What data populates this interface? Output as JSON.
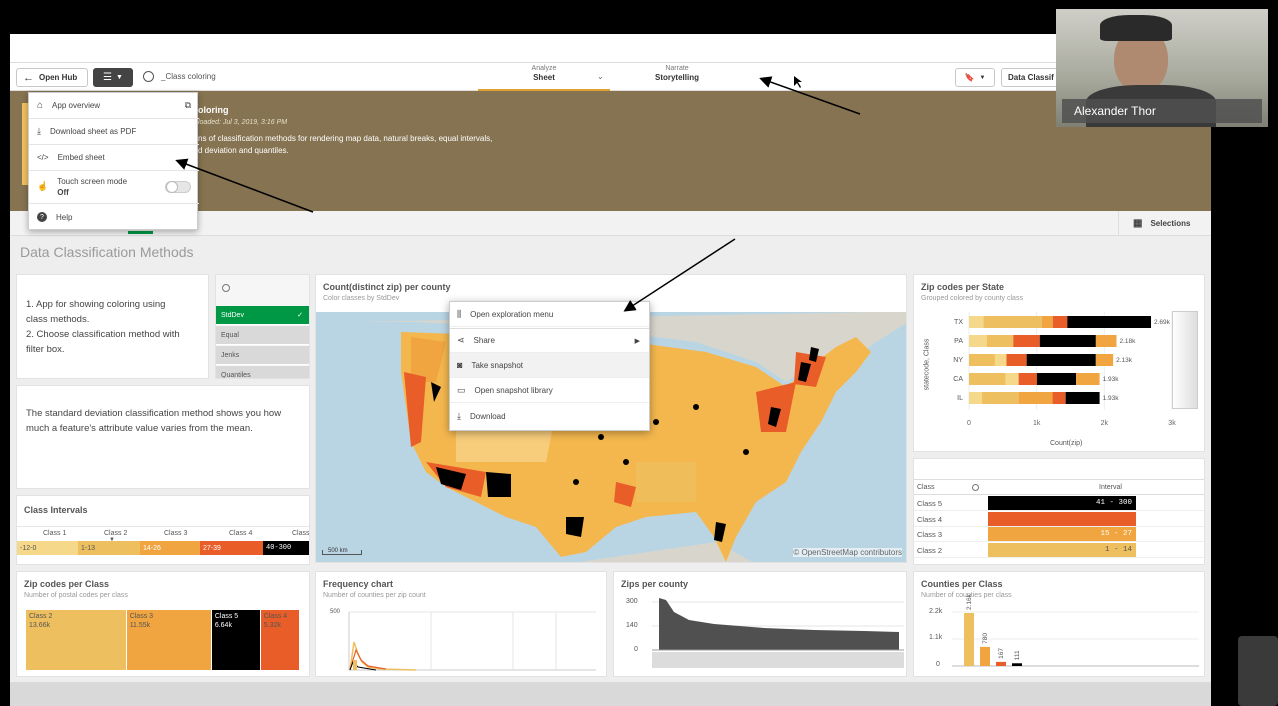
{
  "toolbar": {
    "open_hub": "Open Hub",
    "app_name": "_Class coloring",
    "nav": [
      {
        "top": "Analyze",
        "label": "Sheet"
      },
      {
        "top": "Narrate",
        "label": "Storytelling"
      }
    ],
    "sheet_btn": "Data Classif"
  },
  "menu": {
    "items": [
      {
        "label": "App overview",
        "icon": "home-icon"
      },
      {
        "label": "Download sheet as PDF",
        "icon": "download-icon"
      },
      {
        "label": "Embed sheet",
        "icon": "code-icon"
      },
      {
        "label": "Touch screen mode",
        "state": "Off",
        "icon": "hand-icon"
      },
      {
        "label": "Help",
        "icon": "help-icon"
      }
    ]
  },
  "banner": {
    "title": "oloring",
    "loaded": "loaded: Jul 3, 2019, 3:16 PM",
    "desc1": "ns of classification methods for rendering map data, natural breaks, equal intervals,",
    "desc2": "d deviation and quantiles."
  },
  "selections": "Selections",
  "sheet_title": "Data Classification Methods",
  "intro": {
    "line1": "1. App for showing coloring using",
    "line2": "class methods.",
    "line3": "2. Choose classification method with",
    "line4": "filter box."
  },
  "filter": {
    "items": [
      "StdDev",
      "Equal",
      "Jenks",
      "Quantiles"
    ],
    "selected": "StdDev"
  },
  "description": "The standard deviation classification method shows you how much a feature's attribute value varies from the mean.",
  "class_intervals": {
    "title": "Class Intervals",
    "headers": [
      "Class 1",
      "Class 2",
      "Class 3",
      "Class 4",
      "Class"
    ],
    "values": [
      "-12-0",
      "1-13",
      "14-26",
      "27-39",
      "40-300"
    ]
  },
  "map": {
    "title": "Count(distinct zip) per county",
    "subtitle": "Color classes by StdDev",
    "scale": "500 km",
    "attribution": "© OpenStreetMap contributors"
  },
  "context_menu": {
    "items": [
      {
        "label": "Open exploration menu",
        "icon": "sliders-icon"
      },
      {
        "label": "Share",
        "icon": "share-icon"
      },
      {
        "label": "Take snapshot",
        "icon": "camera-icon"
      },
      {
        "label": "Open snapshot library",
        "icon": "library-icon"
      },
      {
        "label": "Download",
        "icon": "download-icon"
      }
    ]
  },
  "zip_state": {
    "title": "Zip codes per State",
    "subtitle": "Grouped colored by county class",
    "ylabel": "statecode, Class",
    "xlabel": "Count(zip)",
    "xticks": [
      "0",
      "1k",
      "2k",
      "3k"
    ],
    "states": [
      "TX",
      "PA",
      "NY",
      "CA",
      "IL"
    ],
    "values": [
      "2.69k",
      "2.18k",
      "2.13k",
      "1.93k",
      "1.93k"
    ]
  },
  "interval_table": {
    "col1": "Class",
    "col2": "Interval",
    "rows": [
      {
        "cls": "Class 5",
        "val": "41 - 300"
      },
      {
        "cls": "Class 4",
        "val": "28 - 40"
      },
      {
        "cls": "Class 3",
        "val": "15 - 27"
      },
      {
        "cls": "Class 2",
        "val": "1 - 14"
      }
    ]
  },
  "zip_class": {
    "title": "Zip codes per Class",
    "subtitle": "Number of postal codes per class",
    "blocks": [
      {
        "name": "Class 2",
        "val": "13.66k"
      },
      {
        "name": "Class 3",
        "val": "11.55k"
      },
      {
        "name": "Class 5",
        "val": "6.64k"
      },
      {
        "name": "Class 4",
        "val": "5.32k"
      }
    ]
  },
  "frequency": {
    "title": "Frequency chart",
    "subtitle": "Number of counties per zip count",
    "ytick": "500"
  },
  "zips_county": {
    "title": "Zips per county",
    "yticks": [
      "300",
      "140",
      "0"
    ]
  },
  "counties_class": {
    "title": "Counties per Class",
    "subtitle": "Number of counties per class",
    "yticks": [
      "2.2k",
      "1.1k",
      "0"
    ],
    "labels": [
      "2.16k",
      "780",
      "167",
      "111"
    ]
  },
  "webcam": {
    "name": "Alexander Thor"
  },
  "colors": {
    "class1": "#f5d88a",
    "class2": "#edbf5f",
    "class3": "#f0a540",
    "class4": "#e95d28",
    "class5": "#000000",
    "banner": "#857351",
    "green": "#009845"
  }
}
